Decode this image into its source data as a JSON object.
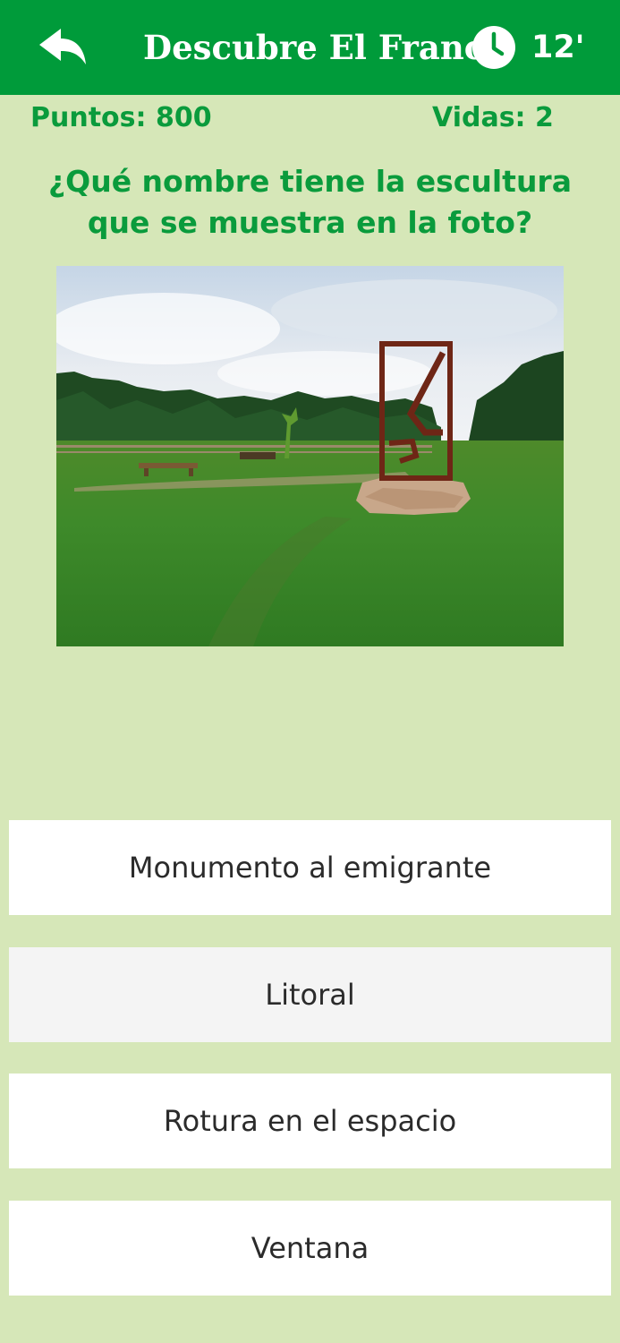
{
  "header": {
    "title": "Descubre El Franco",
    "timer": "12'",
    "back_icon": "reply-arrow-icon",
    "clock_icon": "clock-icon",
    "background_color": "#009b3a"
  },
  "score": {
    "points": "Puntos: 800",
    "lives": "Vidas: 2",
    "color": "#0a9b3c"
  },
  "question": {
    "text": "¿Qué nombre tiene la escultura que se muestra en la foto?"
  },
  "answers": [
    {
      "label": "Monumento al emigrante"
    },
    {
      "label": "Litoral"
    },
    {
      "label": "Rotura en el espacio"
    },
    {
      "label": "Ventana"
    }
  ],
  "theme": {
    "page_background": "#d6e7b8",
    "answer_background": "#ffffff",
    "answer_highlight_background": "#f4f4f4"
  }
}
